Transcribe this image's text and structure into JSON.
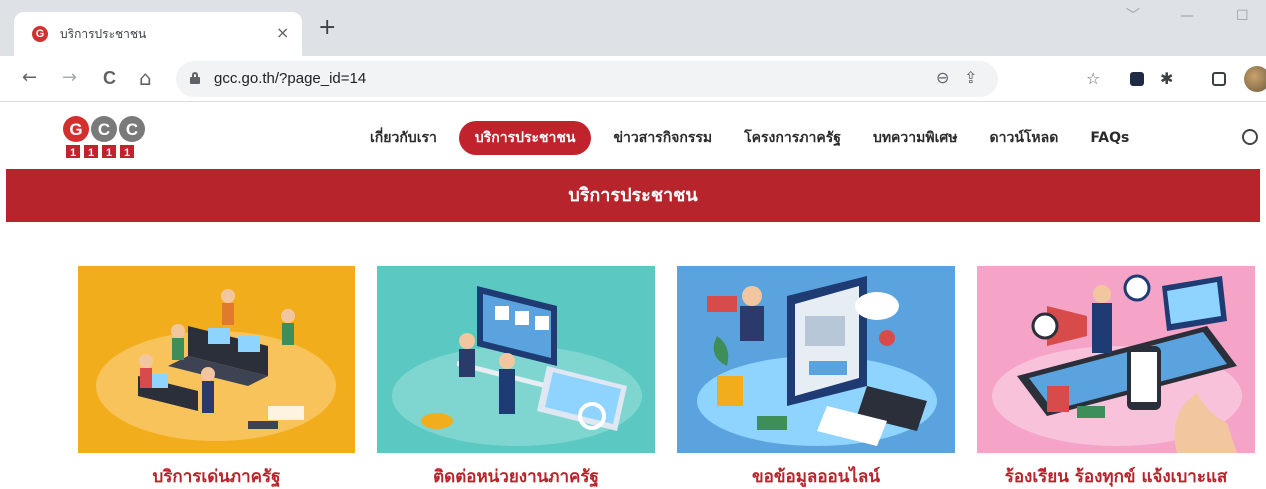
{
  "browser": {
    "tab_title": "บริการประชาชน",
    "tab_close": "×",
    "new_tab": "+",
    "url": "gcc.go.th/?page_id=14",
    "nav": {
      "back": "←",
      "forward": "→",
      "reload": "C",
      "home": "⌂"
    },
    "window_controls": {
      "dropdown": "﹀",
      "minimize": "—",
      "maximize": "☐"
    }
  },
  "site": {
    "logo_text": "GCC",
    "logo_number": "1111",
    "menu": [
      {
        "label": "เกี่ยวกับเรา",
        "active": false
      },
      {
        "label": "บริการประชาชน",
        "active": true
      },
      {
        "label": "ข่าวสารกิจกรรม",
        "active": false
      },
      {
        "label": "โครงการภาครัฐ",
        "active": false
      },
      {
        "label": "บทความพิเศษ",
        "active": false
      },
      {
        "label": "ดาวน์โหลด",
        "active": false
      },
      {
        "label": "FAQs",
        "active": false
      }
    ],
    "banner_title": "บริการประชาชน",
    "cards": [
      {
        "title": "บริการเด่นภาครัฐ",
        "bg": "#f2ad1c"
      },
      {
        "title": "ติดต่อหน่วยงานภาครัฐ",
        "bg": "#5cc8c2"
      },
      {
        "title": "ขอข้อมูลออนไลน์",
        "bg": "#5aa3df"
      },
      {
        "title": "ร้องเรียน ร้องทุกข์ แจ้งเบาะแส",
        "bg": "#f5a3c7"
      }
    ]
  },
  "colors": {
    "brand_red": "#b8242b",
    "active_menu": "#c0232b"
  }
}
